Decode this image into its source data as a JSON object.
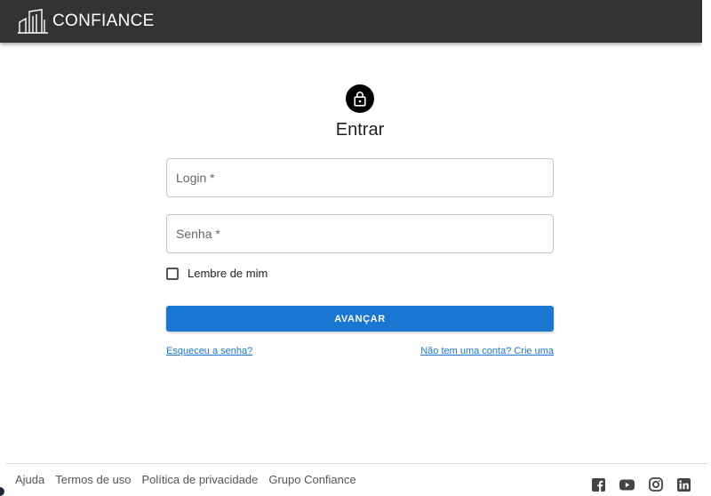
{
  "header": {
    "brand": "CONFIANCE",
    "background": "#353331"
  },
  "login": {
    "lock_icon": "lock-icon",
    "title": "Entrar",
    "login_placeholder": "Login *",
    "password_placeholder": "Senha *",
    "remember_label": "Lembre de mim",
    "remember_checked": false,
    "submit_label": "AVANÇAR",
    "forgot_link": "Esqueceu a senha?",
    "signup_link": "Não tem uma conta? Crie uma",
    "accent": "#1976d2"
  },
  "footer": {
    "links": [
      "Ajuda",
      "Termos de uso",
      "Política de privacidade",
      "Grupo Confiance"
    ],
    "social_icons": [
      "facebook-icon",
      "youtube-icon",
      "instagram-icon",
      "linkedin-icon"
    ]
  }
}
